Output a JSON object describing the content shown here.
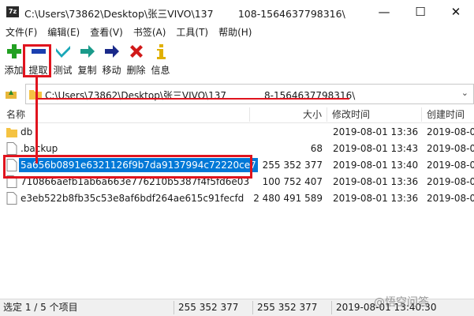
{
  "window": {
    "app_icon_text": "7z",
    "title": "C:\\Users\\73862\\Desktop\\张三VIVO\\137     108-1564637798316\\",
    "min_glyph": "—",
    "max_glyph": "☐",
    "close_glyph": "✕"
  },
  "menu": [
    {
      "label": "文件(F)"
    },
    {
      "label": "编辑(E)"
    },
    {
      "label": "查看(V)"
    },
    {
      "label": "书签(A)"
    },
    {
      "label": "工具(T)"
    },
    {
      "label": "帮助(H)"
    }
  ],
  "toolbar": [
    {
      "label": "添加",
      "icon": "plus-icon",
      "color": "#22a022"
    },
    {
      "label": "提取",
      "icon": "minus-icon",
      "color": "#1a3fb0"
    },
    {
      "label": "测试",
      "icon": "check-icon",
      "color": "#1aa7b8"
    },
    {
      "label": "复制",
      "icon": "copy-arrow-icon",
      "color": "#1a9a8a"
    },
    {
      "label": "移动",
      "icon": "move-arrow-icon",
      "color": "#1a2a8a"
    },
    {
      "label": "删除",
      "icon": "delete-x-icon",
      "color": "#d01818"
    },
    {
      "label": "信息",
      "icon": "info-icon",
      "color": "#e0b000"
    }
  ],
  "address": {
    "path": "C:\\Users\\73862\\Desktop\\张三VIVO\\137        8-1564637798316\\"
  },
  "columns": {
    "name": "名称",
    "size": "大小",
    "modified": "修改时间",
    "created": "创建时间"
  },
  "files": [
    {
      "name": "db",
      "size": "",
      "modified": "2019-08-01 13:36",
      "created": "2019-08-0",
      "type": "folder",
      "selected": false
    },
    {
      "name": ".backup",
      "size": "68",
      "modified": "2019-08-01 13:43",
      "created": "2019-08-0",
      "type": "file",
      "selected": false
    },
    {
      "name": "5a656b0891e6321126f9b7da9137994c72220ce7",
      "size": "255 352 377",
      "modified": "2019-08-01 13:40",
      "created": "2019-08-0",
      "type": "file",
      "selected": true
    },
    {
      "name": "710866aefb1ab6a663e776210b5387f4f5fd6e03",
      "size": "100 752 407",
      "modified": "2019-08-01 13:36",
      "created": "2019-08-0",
      "type": "file",
      "selected": false
    },
    {
      "name": "e3eb522b8fb35c53e8af6bdf264ae615c91fecfd",
      "size": "2 480 491 589",
      "modified": "2019-08-01 13:36",
      "created": "2019-08-0",
      "type": "file",
      "selected": false
    }
  ],
  "status": {
    "selection": "选定 1 / 5 个项目",
    "size": "255 352 377",
    "packed": "255 352 377",
    "time": "2019-08-01 13:40:30"
  },
  "watermark": "@悟空问答",
  "colors": {
    "selection": "#0078d7",
    "annotation": "#e0141e",
    "folder": "#f5c342"
  }
}
